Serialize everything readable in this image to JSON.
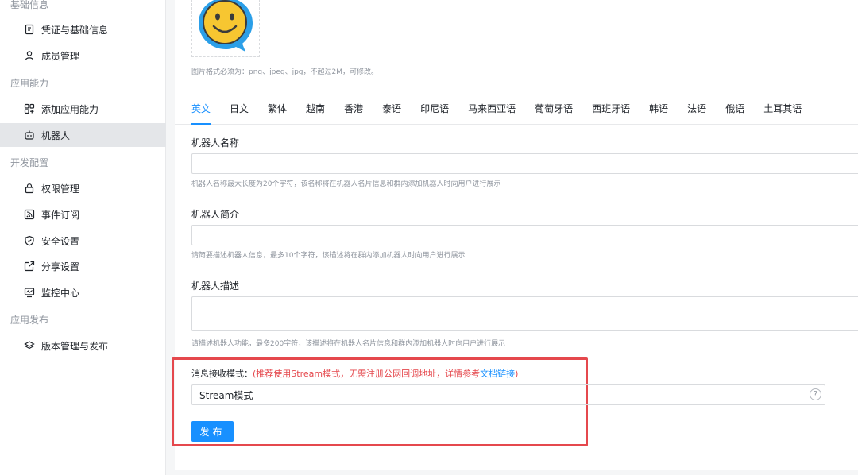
{
  "sidebar": {
    "groups": [
      {
        "title": "基础信息",
        "items": [
          {
            "label": "凭证与基础信息",
            "icon": "credential-icon"
          },
          {
            "label": "成员管理",
            "icon": "user-icon"
          }
        ]
      },
      {
        "title": "应用能力",
        "items": [
          {
            "label": "添加应用能力",
            "icon": "add-capability-icon"
          },
          {
            "label": "机器人",
            "icon": "robot-icon",
            "active": true
          }
        ]
      },
      {
        "title": "开发配置",
        "items": [
          {
            "label": "权限管理",
            "icon": "lock-icon"
          },
          {
            "label": "事件订阅",
            "icon": "rss-icon"
          },
          {
            "label": "安全设置",
            "icon": "shield-icon"
          },
          {
            "label": "分享设置",
            "icon": "share-icon"
          },
          {
            "label": "监控中心",
            "icon": "monitor-icon"
          }
        ]
      },
      {
        "title": "应用发布",
        "items": [
          {
            "label": "版本管理与发布",
            "icon": "layers-icon"
          }
        ]
      }
    ]
  },
  "avatar": {
    "icon": "smiley-chat-icon",
    "hint": "图片格式必须为：png、jpeg、jpg，不超过2M，可修改。"
  },
  "tabs": [
    "英文",
    "日文",
    "繁体",
    "越南",
    "香港",
    "泰语",
    "印尼语",
    "马来西亚语",
    "葡萄牙语",
    "西班牙语",
    "韩语",
    "法语",
    "俄语",
    "土耳其语"
  ],
  "active_tab": "英文",
  "form": {
    "name_label": "机器人名称",
    "name_value": "",
    "name_hint": "机器人名称最大长度为20个字符，该名称将在机器人名片信息和群内添加机器人时向用户进行展示",
    "intro_label": "机器人简介",
    "intro_value": "",
    "intro_hint": "请简要描述机器人信息，最多10个字符，该描述将在群内添加机器人时向用户进行展示",
    "desc_label": "机器人描述",
    "desc_value": "",
    "desc_hint": "请描述机器人功能，最多200字符，该描述将在机器人名片信息和群内添加机器人时向用户进行展示"
  },
  "mode": {
    "label": "消息接收模式：",
    "note_prefix": "(推荐使用Stream模式，无需注册公网回调地址，详情参考",
    "note_link": "文档链接",
    "note_suffix": ")",
    "value": "Stream模式",
    "help": "?"
  },
  "publish_label": "发布",
  "colors": {
    "accent": "#1890ff",
    "highlight_border": "#e5484d",
    "active_nav_bg": "#e4e6e9"
  }
}
